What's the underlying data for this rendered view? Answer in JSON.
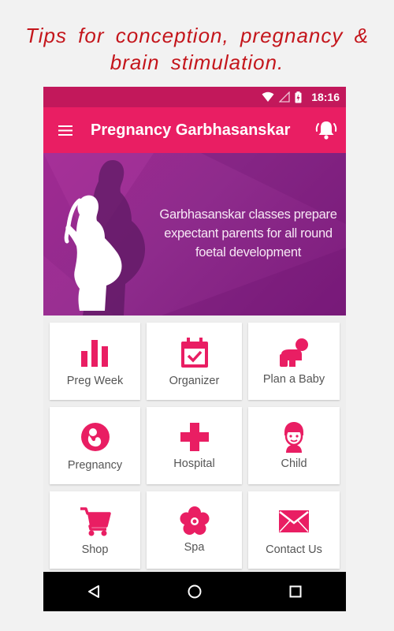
{
  "tagline": {
    "line1": "Tips for conception, pregnancy &",
    "line2": "brain stimulation."
  },
  "status_bar": {
    "time": "18:16"
  },
  "app_bar": {
    "title": "Pregnancy Garbhasanskar"
  },
  "banner": {
    "line1": "Garbhasanskar classes prepare",
    "line2": "expectant parents for all round",
    "line3": "foetal development"
  },
  "tiles": [
    {
      "label": "Preg Week",
      "icon": "bar-chart-icon"
    },
    {
      "label": "Organizer",
      "icon": "calendar-check-icon"
    },
    {
      "label": "Plan a Baby",
      "icon": "crawling-baby-icon"
    },
    {
      "label": "Pregnancy",
      "icon": "fetus-icon"
    },
    {
      "label": "Hospital",
      "icon": "medical-cross-icon"
    },
    {
      "label": "Child",
      "icon": "child-face-icon"
    },
    {
      "label": "Shop",
      "icon": "shopping-cart-icon"
    },
    {
      "label": "Spa",
      "icon": "flower-icon"
    },
    {
      "label": "Contact Us",
      "icon": "envelope-icon"
    }
  ],
  "colors": {
    "tagline": "#c4161c",
    "status_bar": "#c2185b",
    "app_bar": "#e91e63",
    "icon_accent": "#e91e63",
    "banner": "#8e2b8c"
  }
}
